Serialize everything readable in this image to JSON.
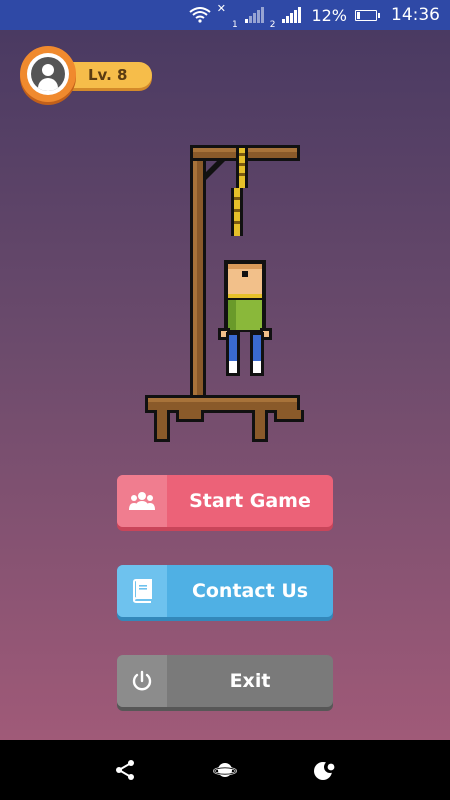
{
  "status_bar": {
    "sim1": "1",
    "sim2": "2",
    "battery": "12%",
    "time": "14:36"
  },
  "level": {
    "label": "Lv. 8"
  },
  "menu": {
    "start_label": "Start Game",
    "contact_label": "Contact Us",
    "exit_label": "Exit"
  },
  "colors": {
    "start": "#ec6278",
    "contact": "#4fb0e4",
    "exit": "#7a7a7a",
    "status_bar": "#2f49a6"
  }
}
